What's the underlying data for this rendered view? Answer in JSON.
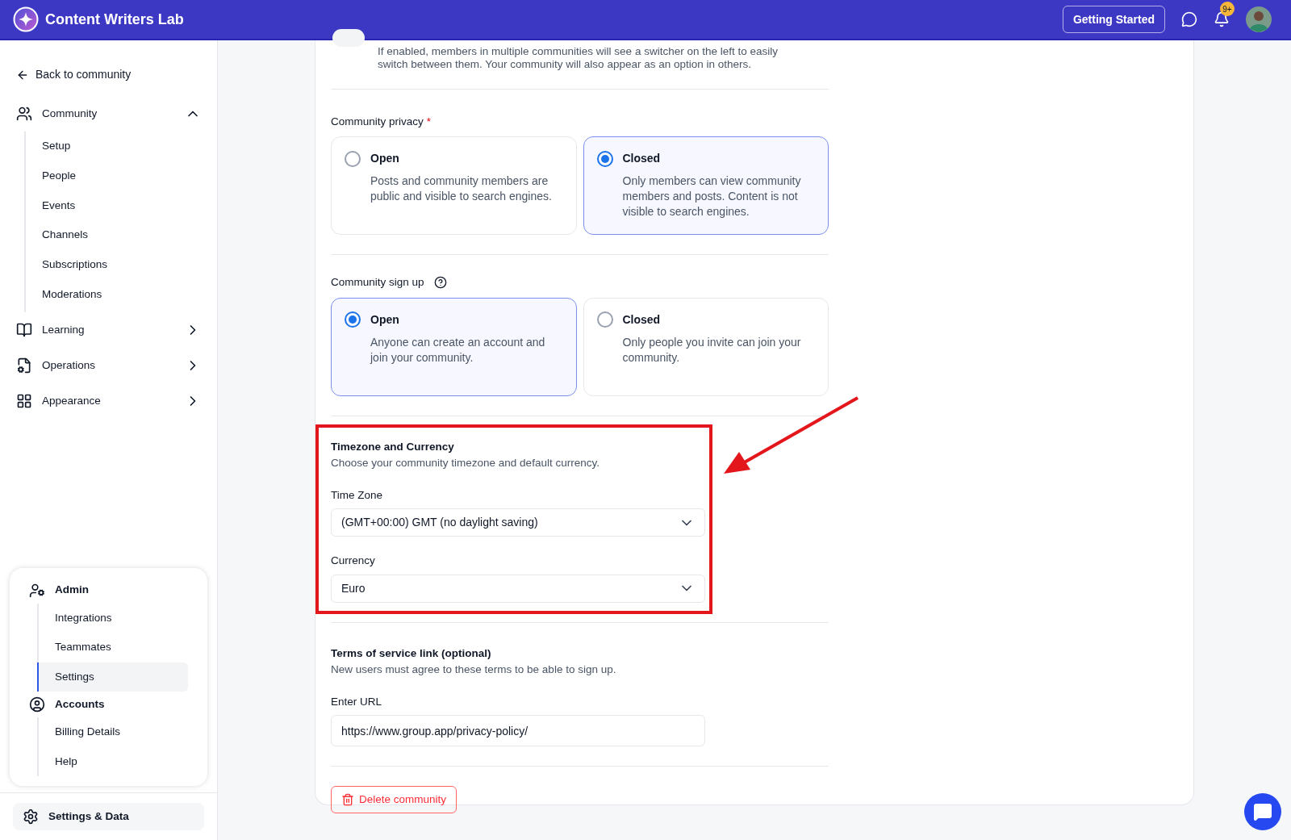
{
  "header": {
    "title": "Content Writers Lab",
    "getting_started": "Getting Started",
    "notification_badge": "9+"
  },
  "sidebar": {
    "back": "Back to community",
    "groups": [
      {
        "label": "Community",
        "kind": "community",
        "expanded": true,
        "children": [
          {
            "label": "Setup"
          },
          {
            "label": "People"
          },
          {
            "label": "Events"
          },
          {
            "label": "Channels"
          },
          {
            "label": "Subscriptions"
          },
          {
            "label": "Moderations"
          }
        ]
      },
      {
        "label": "Learning",
        "kind": "book",
        "expanded": false
      },
      {
        "label": "Operations",
        "kind": "ops",
        "expanded": false
      },
      {
        "label": "Appearance",
        "kind": "grid",
        "expanded": false
      }
    ],
    "admin": [
      {
        "label": "Admin",
        "kind": "admin",
        "children": [
          {
            "label": "Integrations",
            "selected": false
          },
          {
            "label": "Teammates",
            "selected": false
          },
          {
            "label": "Settings",
            "selected": true
          }
        ]
      },
      {
        "label": "Accounts",
        "kind": "account",
        "children": [
          {
            "label": "Billing Details",
            "selected": false
          },
          {
            "label": "Help",
            "selected": false
          }
        ]
      }
    ],
    "footer": "Settings & Data"
  },
  "settings": {
    "switcher_toggle": {
      "on": false
    },
    "switcher_description": "If enabled, members in multiple communities will see a switcher on the left to easily switch between them. Your community will also appear as an option in others.",
    "privacy": {
      "label": "Community privacy",
      "required_mark": "*",
      "options": [
        {
          "title": "Open",
          "description": "Posts and community members are public and visible to search engines.",
          "selected": false
        },
        {
          "title": "Closed",
          "description": "Only members can view community members and posts. Content is not visible to search engines.",
          "selected": true
        }
      ]
    },
    "signup": {
      "label": "Community sign up",
      "options": [
        {
          "title": "Open",
          "description": "Anyone can create an account and join your community.",
          "selected": true
        },
        {
          "title": "Closed",
          "description": "Only people you invite can join your community.",
          "selected": false
        }
      ]
    },
    "timezone_currency": {
      "title": "Timezone and Currency",
      "description": "Choose your community timezone and default currency.",
      "fields": [
        {
          "label": "Time Zone",
          "value": "(GMT+00:00) GMT (no daylight saving)"
        },
        {
          "label": "Currency",
          "value": "Euro"
        }
      ]
    },
    "terms": {
      "title": "Terms of service link (optional)",
      "description": "New users must agree to these terms to be able to sign up.",
      "field_label": "Enter URL",
      "value": "https://www.group.app/privacy-policy/"
    },
    "delete_button": "Delete community"
  }
}
